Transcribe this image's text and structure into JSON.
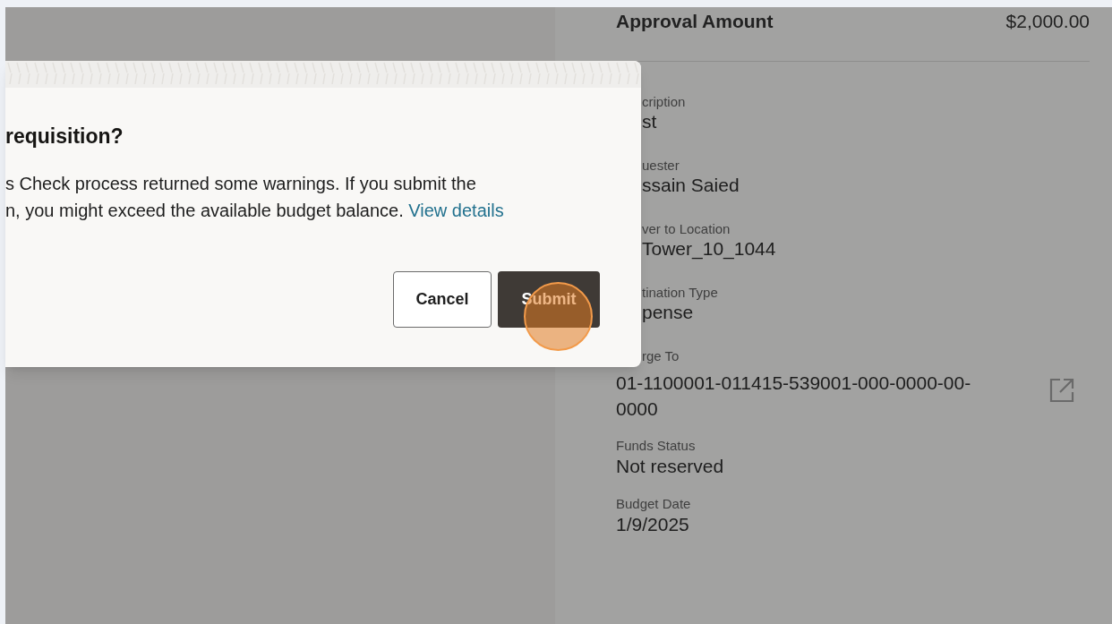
{
  "summary": {
    "label": "Approval Amount",
    "value": "$2,000.00"
  },
  "covered_fields": [
    {
      "label": "cription",
      "value": "st"
    },
    {
      "label": "uester",
      "value": "ssain Saied"
    },
    {
      "label": "ver to Location",
      "value": "Tower_10_1044"
    },
    {
      "label": "tination Type",
      "value": "pense"
    },
    {
      "label": "rge To"
    }
  ],
  "charge_value": "01-1100001-011415-539001-000-0000-00-0000",
  "fields": [
    {
      "label": "Funds Status",
      "value": "Not reserved"
    },
    {
      "label": "Budget Date",
      "value": "1/9/2025"
    }
  ],
  "dialog": {
    "title": "requisition?",
    "lines": [
      "s Check process returned some warnings. If you submit the",
      "n, you might exceed the available budget balance."
    ],
    "link": "View details",
    "buttons": [
      {
        "label": "Cancel",
        "kind": "secondary"
      },
      {
        "label": "Submit",
        "kind": "primary"
      }
    ]
  }
}
